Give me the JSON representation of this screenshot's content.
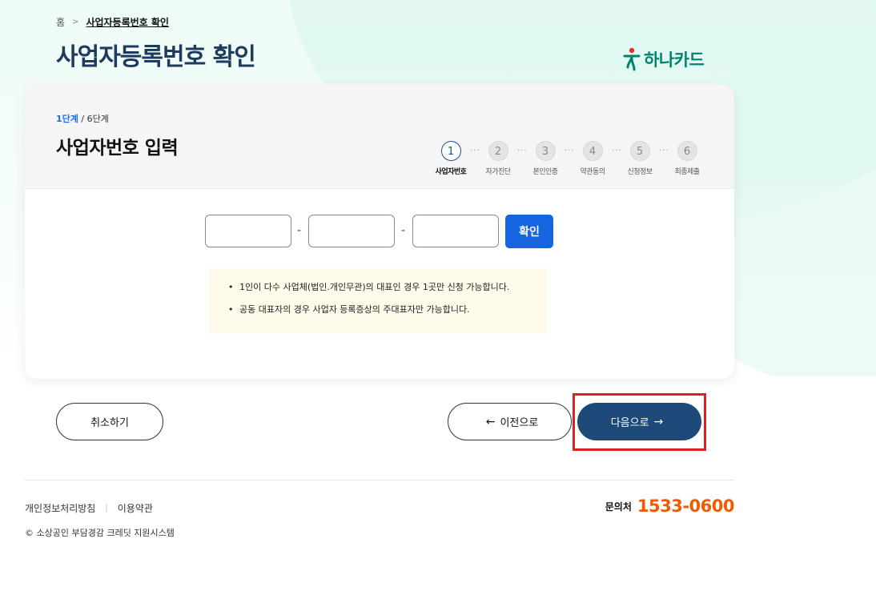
{
  "breadcrumb": {
    "home": "홈",
    "current": "사업자등록번호 확인"
  },
  "page_title": "사업자등록번호 확인",
  "logo": {
    "text": "하나카드",
    "color": "#00836d"
  },
  "card": {
    "step_current": "1단계",
    "step_total": " / 6단계",
    "title": "사업자번호 입력",
    "steps": [
      {
        "num": "1",
        "label": "사업자번호",
        "active": true
      },
      {
        "num": "2",
        "label": "자가진단",
        "active": false
      },
      {
        "num": "3",
        "label": "본인인증",
        "active": false
      },
      {
        "num": "4",
        "label": "약관동의",
        "active": false
      },
      {
        "num": "5",
        "label": "신청정보",
        "active": false
      },
      {
        "num": "6",
        "label": "최종제출",
        "active": false
      }
    ],
    "inputs": {
      "part1": "",
      "part2": "",
      "part3": ""
    },
    "confirm_button": "확인",
    "notices": [
      "1인이 다수 사업체(법인.개인무관)의 대표인 경우 1곳만 신청 가능합니다.",
      "공동 대표자의 경우 사업자 등록증상의 주대표자만 가능합니다."
    ]
  },
  "actions": {
    "cancel": "취소하기",
    "prev": "이전으로",
    "next": "다음으로"
  },
  "footer": {
    "privacy": "개인정보처리방침",
    "terms": "이용약관",
    "contact_label": "문의처",
    "contact_number": "1533-0600",
    "copyright": "© 소상공인 부담경감 크레딧 지원시스템"
  },
  "colors": {
    "title": "#1d3a5f",
    "primary": "#1565e0",
    "next_button": "#1d4a78",
    "highlight": "#e02020",
    "contact_number": "#f05a00"
  },
  "icons": {
    "arrow_left": "arrow-left-icon",
    "arrow_right": "arrow-right-icon",
    "breadcrumb_sep": "chevron-right-icon"
  }
}
